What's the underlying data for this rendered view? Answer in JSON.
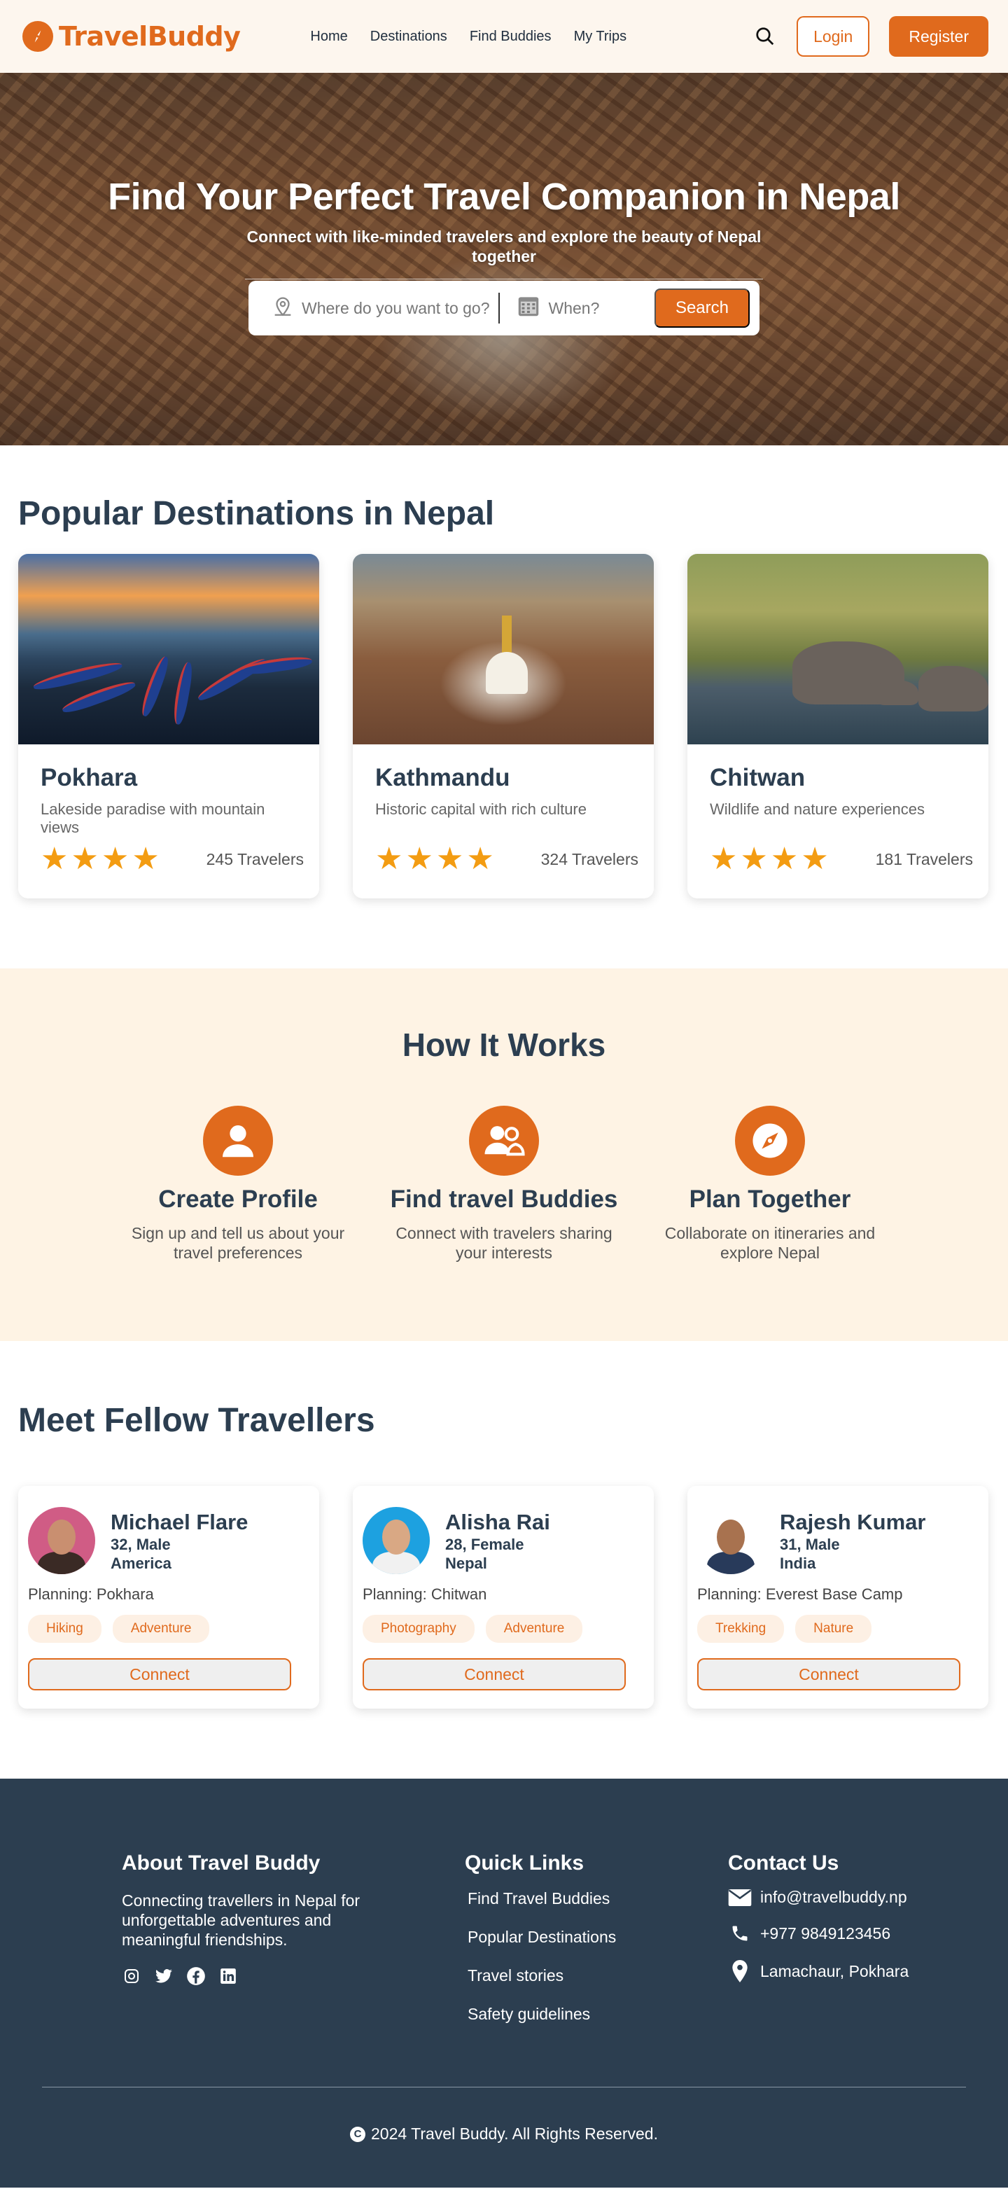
{
  "brand": {
    "name": "TravelBuddy",
    "accent": "#e06a1d",
    "footer_bg": "#2c3e50"
  },
  "nav": {
    "links": [
      "Home",
      "Destinations",
      "Find Buddies",
      "My Trips"
    ],
    "login": "Login",
    "register": "Register"
  },
  "hero": {
    "title": "Find Your Perfect Travel Companion in Nepal",
    "subtitle": "Connect with like-minded travelers and explore the beauty of Nepal together",
    "where_placeholder": "Where do you want to go?",
    "when_placeholder": "When?",
    "search_label": "Search"
  },
  "destinations": {
    "title": "Popular Destinations in Nepal",
    "items": [
      {
        "name": "Pokhara",
        "desc": "Lakeside paradise with mountain views",
        "rating": 4,
        "travelers": "245 Travelers"
      },
      {
        "name": "Kathmandu",
        "desc": "Historic capital with rich culture",
        "rating": 4,
        "travelers": "324 Travelers"
      },
      {
        "name": "Chitwan",
        "desc": "Wildlife and nature experiences",
        "rating": 4,
        "travelers": "181 Travelers"
      }
    ]
  },
  "how": {
    "title": "How It Works",
    "steps": [
      {
        "icon": "user-icon",
        "title": "Create Profile",
        "desc": "Sign up and tell us about your travel preferences"
      },
      {
        "icon": "users-icon",
        "title": "Find travel Buddies",
        "desc": "Connect with travelers sharing your interests"
      },
      {
        "icon": "compass-icon",
        "title": "Plan Together",
        "desc": "Collaborate on itineraries and explore Nepal"
      }
    ]
  },
  "travellers": {
    "title": "Meet Fellow Travellers",
    "connect_label": "Connect",
    "items": [
      {
        "name": "Michael Flare",
        "age_gender": "32, Male",
        "country": "America",
        "planning": "Planning: Pokhara",
        "tags": [
          "Hiking",
          "Adventure"
        ]
      },
      {
        "name": "Alisha Rai",
        "age_gender": "28, Female",
        "country": "Nepal",
        "planning": "Planning: Chitwan",
        "tags": [
          "Photography",
          "Adventure"
        ]
      },
      {
        "name": "Rajesh Kumar",
        "age_gender": "31, Male",
        "country": "India",
        "planning": "Planning: Everest Base Camp",
        "tags": [
          "Trekking",
          "Nature"
        ]
      }
    ]
  },
  "footer": {
    "about_title": "About Travel Buddy",
    "about_text": "Connecting travellers in Nepal for unforgettable adventures and meaningful friendships.",
    "social_icons": [
      "instagram-icon",
      "twitter-icon",
      "facebook-icon",
      "linkedin-icon"
    ],
    "links_title": "Quick Links",
    "links": [
      "Find Travel Buddies",
      "Popular Destinations",
      "Travel stories",
      "Safety guidelines"
    ],
    "contact_title": "Contact Us",
    "email": "info@travelbuddy.np",
    "phone": "+977 9849123456",
    "address": "Lamachaur, Pokhara",
    "copyright": "2024 Travel Buddy. All Rights Reserved."
  }
}
